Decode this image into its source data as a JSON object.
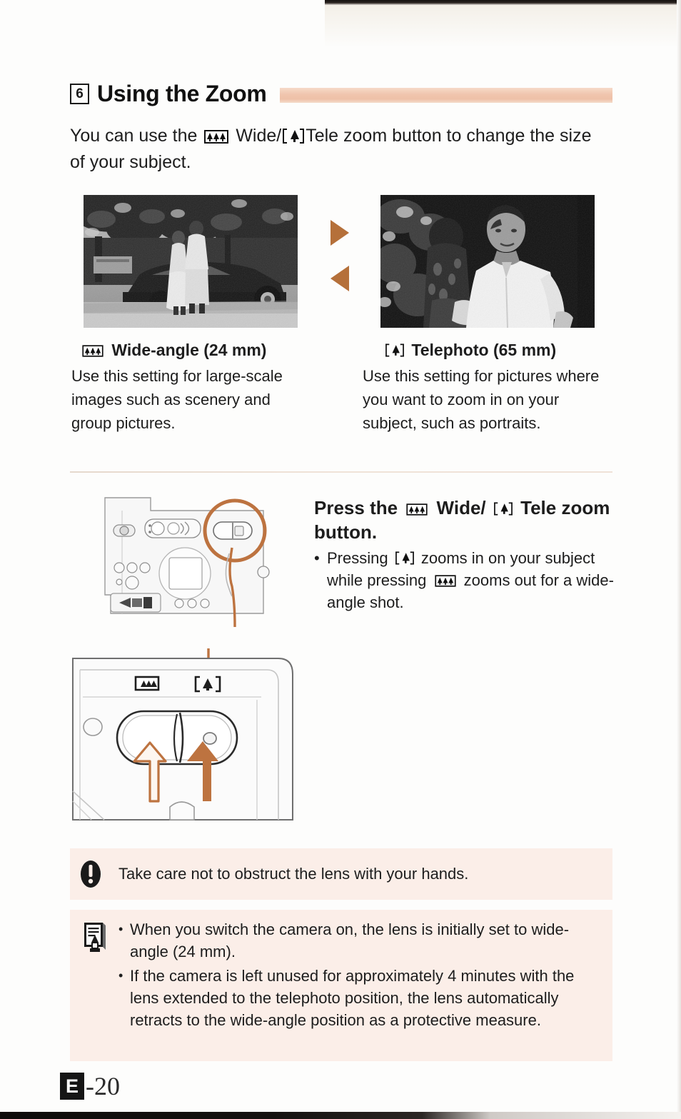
{
  "page": {
    "step_number": "6",
    "title": "Using the Zoom",
    "intro_before": "You can use the",
    "intro_mid": "Wide/",
    "intro_after": "Tele zoom button to change the size of your subject.",
    "accent_color": "#b5703a",
    "header_bar_color": "#f0c5ad",
    "note_bg_color": "#fbeee8"
  },
  "icons": {
    "wide": "wide-angle-icon",
    "tele": "telephoto-icon",
    "arrow_right": "triangle-right-icon",
    "arrow_left": "triangle-left-icon",
    "caution": "caution-exclamation-icon",
    "note": "memo-pencil-icon"
  },
  "examples": [
    {
      "photo_name": "wide-angle-sample-photo",
      "photo_alt": "Two people standing beside a dark car under trees",
      "title": "Wide-angle (24 mm)",
      "body": "Use this setting for large-scale images such as scenery and group pictures."
    },
    {
      "photo_name": "telephoto-sample-photo",
      "photo_alt": "Close-up portrait of a man in a white shirt",
      "title": "Telephoto (65 mm)",
      "body": "Use this setting for pictures where you want to zoom in on your subject, such as portraits."
    }
  ],
  "step": {
    "heading_before": "Press the",
    "heading_mid": "Wide/",
    "heading_after": "Tele zoom button.",
    "bullet_part1": "Pressing",
    "bullet_part2": "zooms in on your subject while pressing",
    "bullet_part3": "zooms out for a wide-angle shot."
  },
  "diagram": {
    "camera_back_name": "camera-back-illustration",
    "zoom_detail_name": "zoom-button-detail-illustration",
    "wide_button_label": "wide-angle-icon",
    "tele_button_label": "telephoto-icon",
    "wide_arrow_label": "press-wide-arrow",
    "tele_arrow_label": "press-tele-arrow",
    "highlight_label": "zoom-button-highlight-circle"
  },
  "caution": {
    "text": "Take care not to obstruct the lens with your hands."
  },
  "notes": [
    "When you switch the camera on, the lens is initially set to wide-angle (24 mm).",
    "If the camera is left unused for approximately 4 minutes with the lens extended to the telephoto position, the lens automatically retracts to the wide-angle position as a protective measure."
  ],
  "footer": {
    "badge": "E",
    "number": "-20"
  }
}
